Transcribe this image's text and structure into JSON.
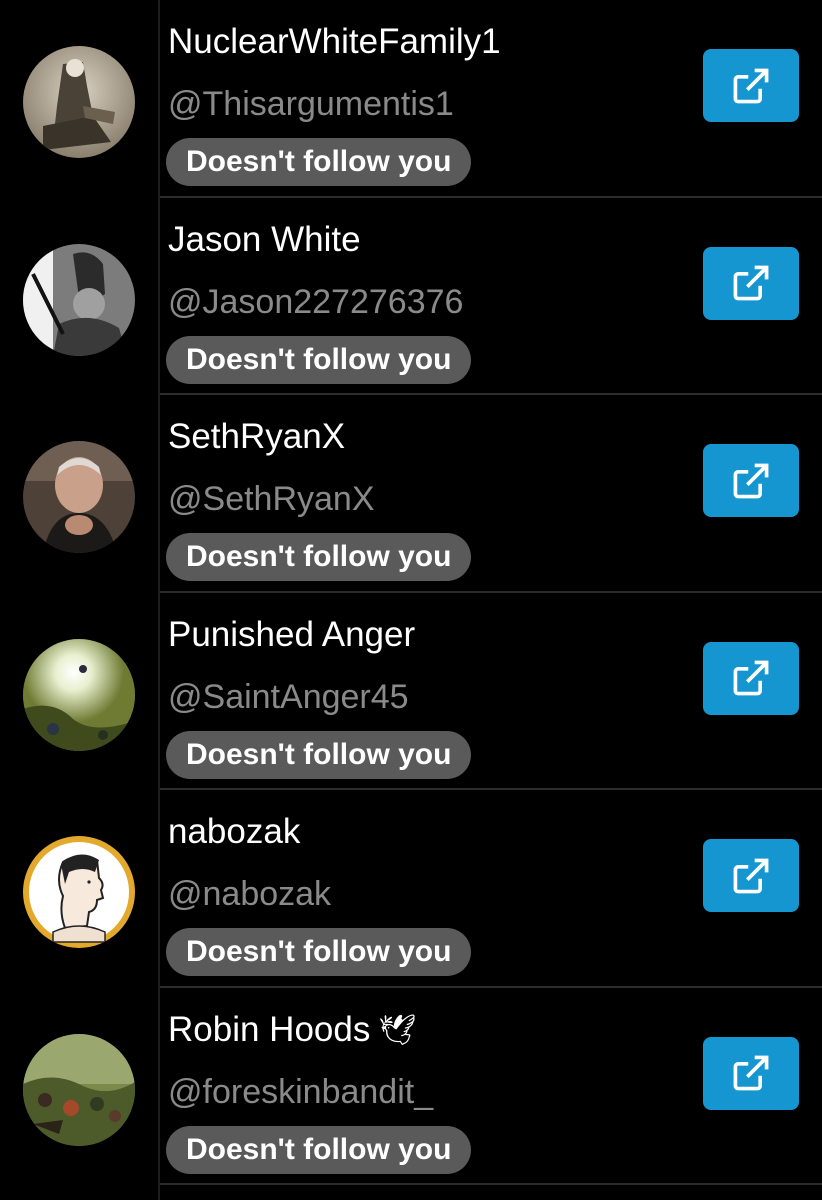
{
  "users": [
    {
      "display_name": "NuclearWhiteFamily1",
      "handle": "@Thisargumentis1",
      "status": "Doesn't follow you",
      "emoji": "",
      "avatar": "avatar-sepia-photo"
    },
    {
      "display_name": "Jason White",
      "handle": "@Jason227276376",
      "status": "Doesn't follow you",
      "emoji": "",
      "avatar": "avatar-bw-soldier"
    },
    {
      "display_name": "SethRyanX",
      "handle": "@SethRyanX",
      "status": "Doesn't follow you",
      "emoji": "",
      "avatar": "avatar-man-photo"
    },
    {
      "display_name": "Punished Anger",
      "handle": "@SaintAnger45",
      "status": "Doesn't follow you",
      "emoji": "",
      "avatar": "avatar-green-painting"
    },
    {
      "display_name": "nabozak",
      "handle": "@nabozak",
      "status": "Doesn't follow you",
      "emoji": "",
      "avatar": "avatar-cartoon-profile"
    },
    {
      "display_name": "Robin Hoods",
      "handle": "@foreskinbandit_",
      "status": "Doesn't follow you",
      "emoji": "🕊",
      "avatar": "avatar-forest-painting"
    }
  ],
  "colors": {
    "background": "#000000",
    "button": "#1596d1",
    "badge": "#5a5a5a",
    "handle_text": "#8a8a8a"
  },
  "icons": {
    "open_button": "external-link-icon"
  }
}
